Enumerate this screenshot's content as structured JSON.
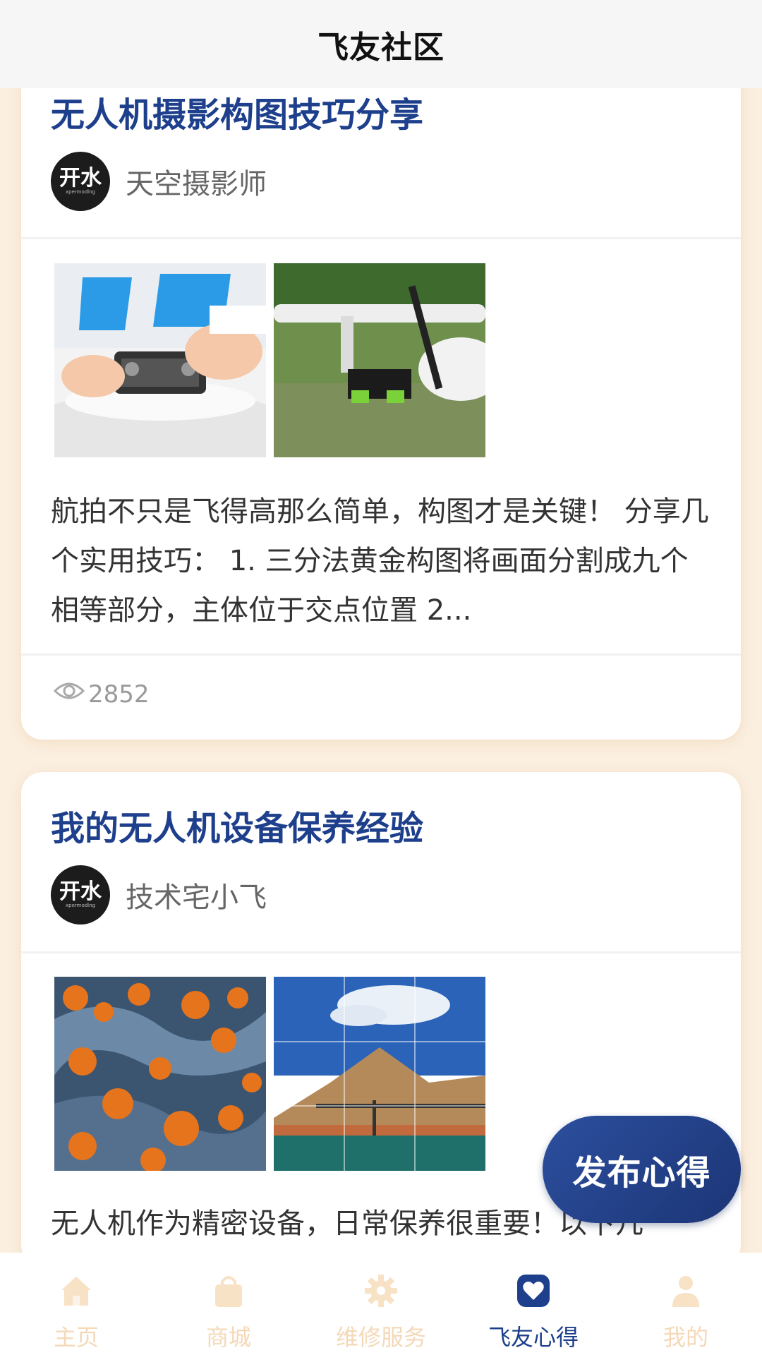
{
  "header": {
    "title": "飞友社区"
  },
  "posts": [
    {
      "title": "无人机摄影构图技巧分享",
      "author": "天空摄影师",
      "avatar_text": "开水",
      "avatar_subtext": "xpermodlng",
      "excerpt": "航拍不只是飞得高那么简单，构图才是关键！ 分享几个实用技巧： 1. 三分法黄金构图将画面分割成九个相等部分，主体位于交点位置 2...",
      "views": "2852",
      "images": [
        "drone-assembly-photo",
        "fixed-wing-drone-on-grass-photo"
      ]
    },
    {
      "title": "我的无人机设备保养经验",
      "author": "技术宅小飞",
      "avatar_text": "开水",
      "avatar_subtext": "xpermodlng",
      "excerpt": "无人机作为精密设备，日常保养很重要！以下几",
      "images": [
        "aerial-autumn-trees-photo",
        "mountain-bridge-landscape-photo"
      ]
    }
  ],
  "fab": {
    "label": "发布心得"
  },
  "tabbar": {
    "items": [
      {
        "label": "主页",
        "icon": "home-icon"
      },
      {
        "label": "商城",
        "icon": "shopping-bag-icon"
      },
      {
        "label": "维修服务",
        "icon": "gear-icon"
      },
      {
        "label": "飞友心得",
        "icon": "heart-chat-icon",
        "active": true
      },
      {
        "label": "我的",
        "icon": "user-icon"
      }
    ]
  },
  "colors": {
    "accent": "#1d3f8c",
    "inactive_tab": "#f4d9b8",
    "background": "#fbefe0"
  }
}
